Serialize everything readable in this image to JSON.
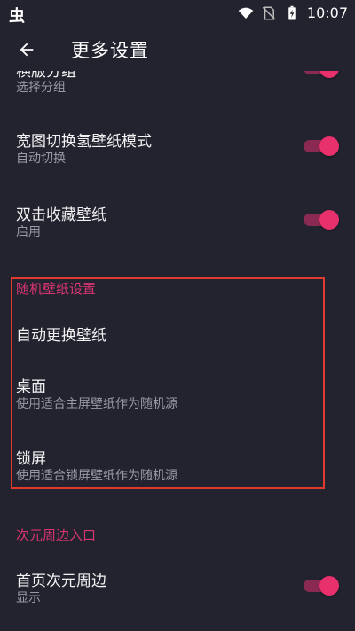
{
  "status_bar": {
    "left_glyph": "虫",
    "time": "10:07",
    "icons": [
      "wifi-icon",
      "no-sim-icon",
      "battery-charging-icon"
    ]
  },
  "app_bar": {
    "back_icon": "arrow-left-icon",
    "title": "更多设置"
  },
  "items": {
    "group_partial": {
      "title": "横版分组",
      "subtitle": "选择分组",
      "switch_on": true
    },
    "wide_switch": {
      "title": "宽图切换氢壁纸模式",
      "subtitle": "自动切换",
      "switch_on": true
    },
    "double_tap": {
      "title": "双击收藏壁纸",
      "subtitle": "启用",
      "switch_on": true
    }
  },
  "random_section": {
    "header": "随机壁纸设置",
    "auto_change": {
      "title": "自动更换壁纸"
    },
    "desktop": {
      "title": "桌面",
      "subtitle": "使用适合主屏壁纸作为随机源"
    },
    "lockscreen": {
      "title": "锁屏",
      "subtitle": "使用适合锁屏壁纸作为随机源"
    }
  },
  "acg_section": {
    "header": "次元周边入口",
    "home_acg": {
      "title": "首页次元周边",
      "subtitle": "显示",
      "switch_on": true
    }
  },
  "colors": {
    "background": "#232330",
    "accent": "#e8306c",
    "highlight_border": "#e0392d"
  }
}
